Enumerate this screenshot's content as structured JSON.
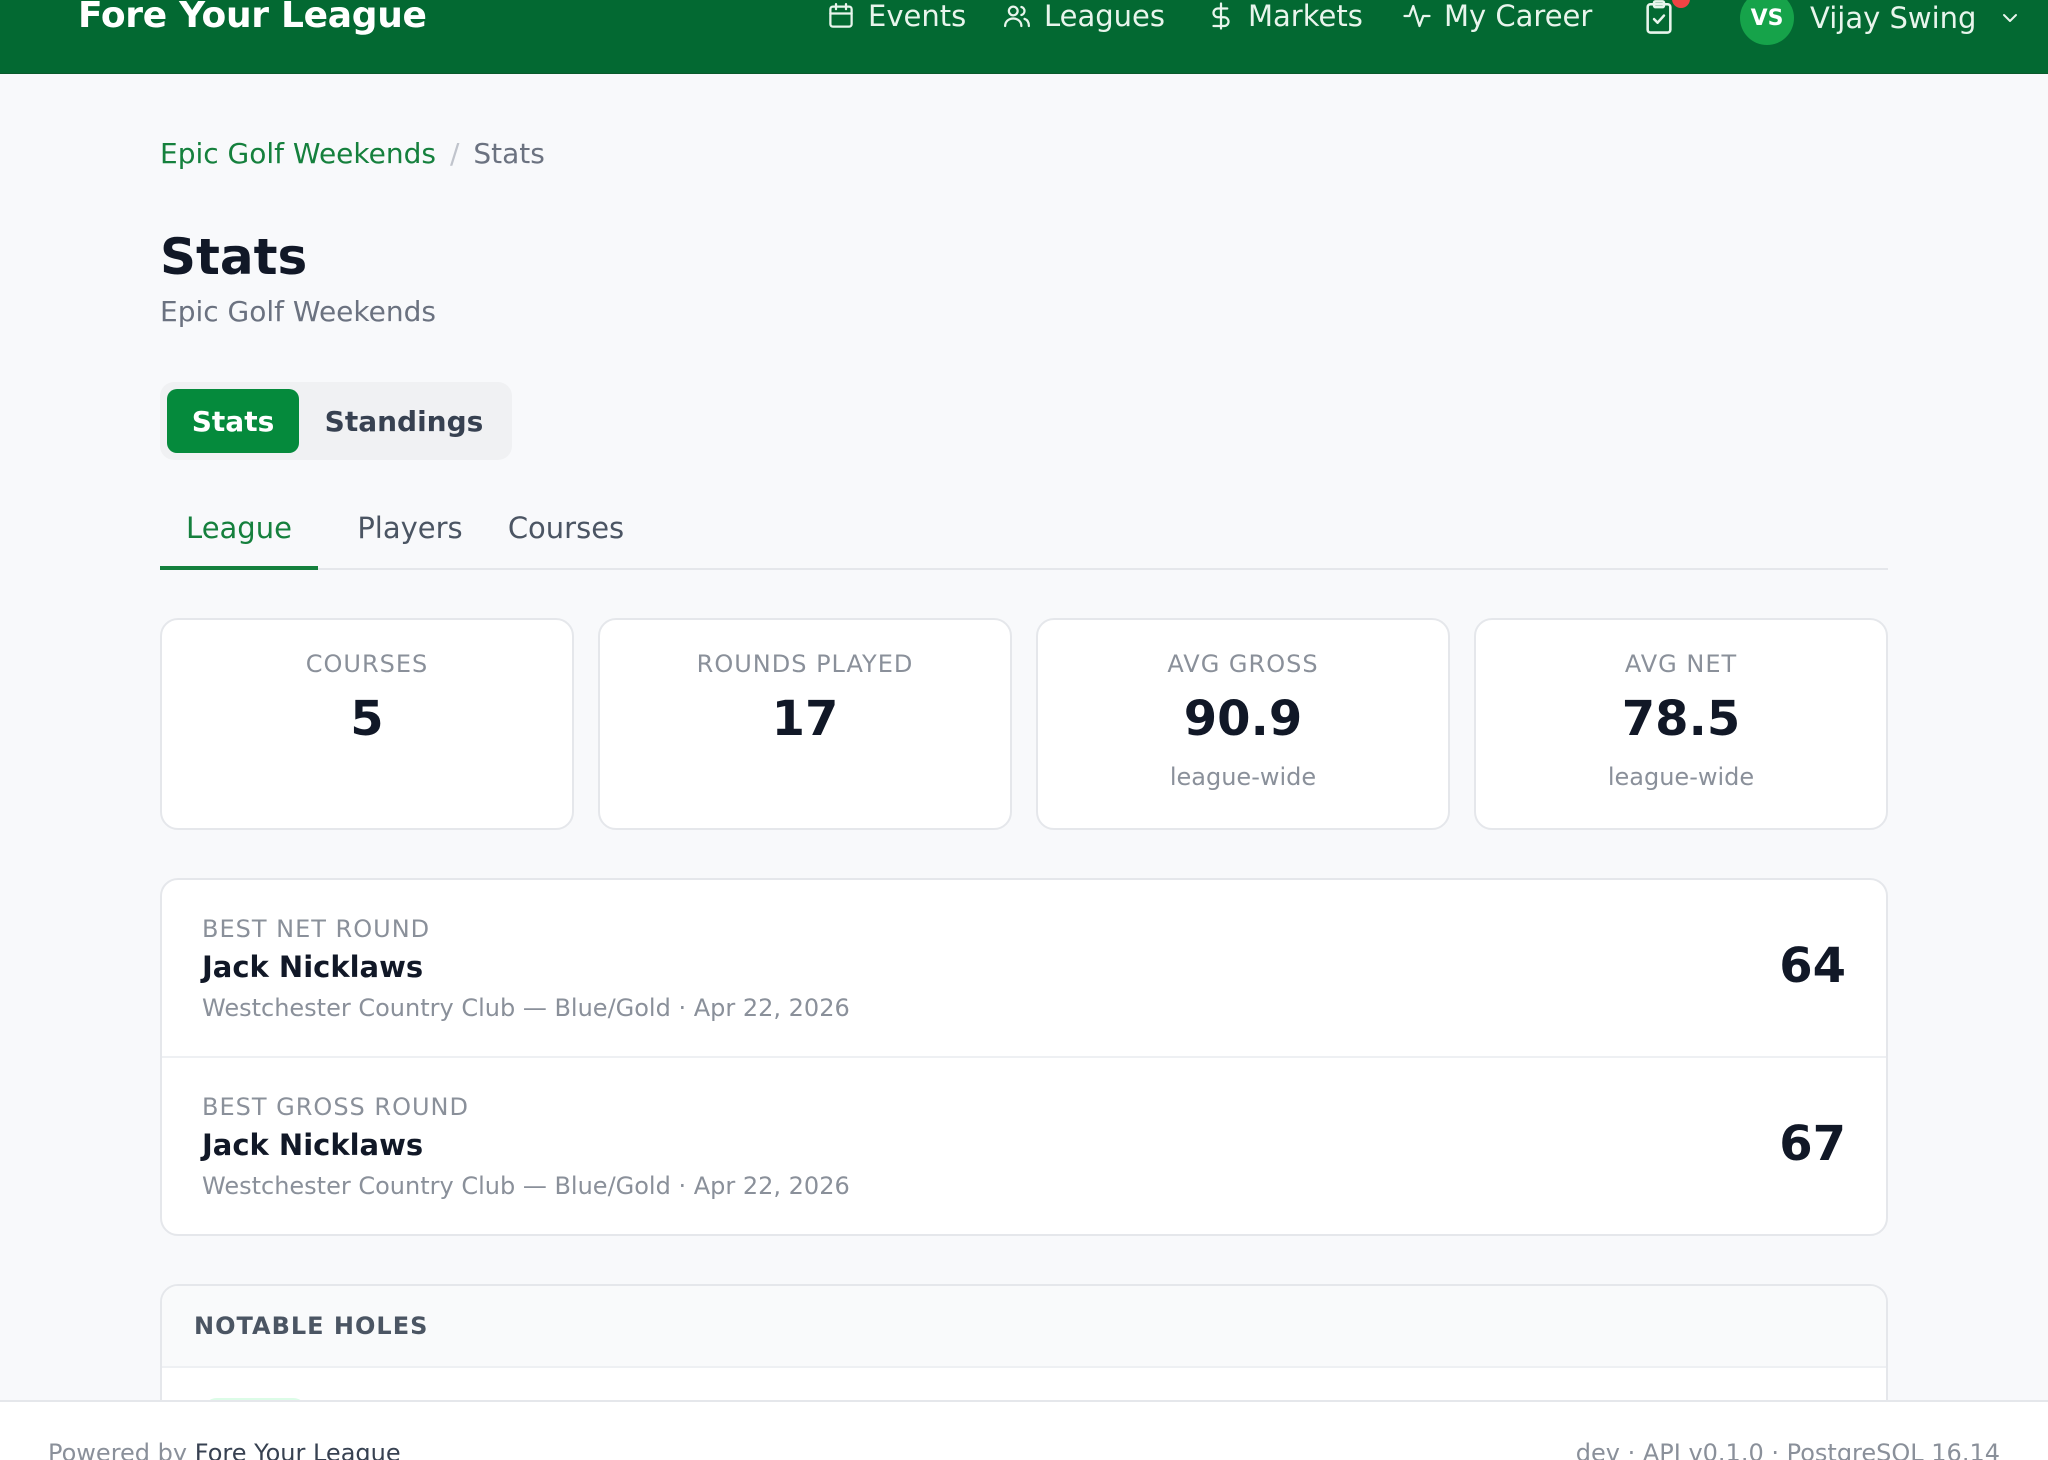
{
  "app": {
    "brand": "Fore Your League"
  },
  "nav": {
    "items": [
      {
        "label": "Events",
        "icon": "calendar-icon"
      },
      {
        "label": "Leagues",
        "icon": "users-icon"
      },
      {
        "label": "Markets",
        "icon": "dollar-icon"
      },
      {
        "label": "My Career",
        "icon": "activity-icon"
      }
    ],
    "tasks_icon": "clipboard-check-icon",
    "user": {
      "initials": "VS",
      "name": "Vijay Swing"
    }
  },
  "breadcrumb": {
    "parent": "Epic Golf Weekends",
    "separator": "/",
    "current": "Stats"
  },
  "header": {
    "title": "Stats",
    "subtitle": "Epic Golf Weekends"
  },
  "segmented": {
    "options": [
      "Stats",
      "Standings"
    ],
    "selected": "Stats"
  },
  "subtabs": {
    "items": [
      "League",
      "Players",
      "Courses"
    ],
    "selected": "League"
  },
  "summary_cards": [
    {
      "label": "COURSES",
      "value": "5",
      "note": ""
    },
    {
      "label": "ROUNDS PLAYED",
      "value": "17",
      "note": ""
    },
    {
      "label": "AVG GROSS",
      "value": "90.9",
      "note": "league-wide"
    },
    {
      "label": "AVG NET",
      "value": "78.5",
      "note": "league-wide"
    }
  ],
  "best_rounds": [
    {
      "label": "BEST NET ROUND",
      "player": "Jack Nicklaws",
      "detail": "Westchester Country Club — Blue/Gold · Apr 22, 2026",
      "score": "64"
    },
    {
      "label": "BEST GROSS ROUND",
      "player": "Jack Nicklaws",
      "detail": "Westchester Country Club — Blue/Gold · Apr 22, 2026",
      "score": "67"
    }
  ],
  "notable_holes": {
    "title": "NOTABLE HOLES"
  },
  "footer": {
    "powered_prefix": "Powered by",
    "powered_brand": "Fore Your League",
    "version": "dev · API v0.1.0 · PostgreSQL 16.14"
  },
  "colors": {
    "brand_green": "#036932",
    "accent_green": "#15803d",
    "button_green": "#058a3c",
    "badge_red": "#ef4444"
  }
}
